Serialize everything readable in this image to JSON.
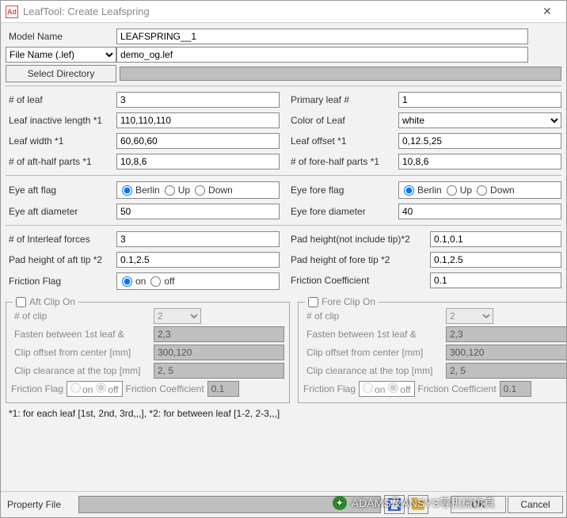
{
  "window": {
    "title": "LeafTool: Create Leafspring",
    "logo_text": "Ad"
  },
  "top": {
    "model_name_label": "Model Name",
    "model_name_value": "LEAFSPRING__1",
    "file_select_label": "File Name (.lef)",
    "file_name_value": "demo_og.lef",
    "select_dir_label": "Select Directory"
  },
  "left": {
    "num_leaf_label": "# of leaf",
    "num_leaf_value": "3",
    "inactive_len_label": "Leaf inactive length *1",
    "inactive_len_value": "110,110,110",
    "width_label": "Leaf width *1",
    "width_value": "60,60,60",
    "aft_half_label": "# of aft-half parts *1",
    "aft_half_value": "10,8,6",
    "eye_aft_flag_label": "Eye aft flag",
    "eye_opts": {
      "a": "Berlin",
      "b": "Up",
      "c": "Down"
    },
    "eye_aft_dia_label": "Eye aft diameter",
    "eye_aft_dia_value": "50",
    "interleaf_label": "# of Interleaf forces",
    "interleaf_value": "3",
    "pad_aft_tip_label": "Pad height of aft tip *2",
    "pad_aft_tip_value": "0.1,2.5",
    "friction_flag_label": "Friction Flag",
    "friction_opts": {
      "on": "on",
      "off": "off"
    }
  },
  "right": {
    "primary_leaf_label": "Primary leaf #",
    "primary_leaf_value": "1",
    "color_label": "Color of Leaf",
    "color_value": "white",
    "offset_label": "Leaf offset *1",
    "offset_value": "0,12.5,25",
    "fore_half_label": "# of fore-half parts *1",
    "fore_half_value": "10,8,6",
    "eye_fore_flag_label": "Eye fore flag",
    "eye_fore_dia_label": "Eye fore diameter",
    "eye_fore_dia_value": "40",
    "pad_height_label": "Pad height(not include tip)*2",
    "pad_height_value": "0.1,0.1",
    "pad_fore_tip_label": "Pad height of fore tip *2",
    "pad_fore_tip_value": "0.1,2.5",
    "friction_coef_label": "Friction Coefficient",
    "friction_coef_value": "0.1"
  },
  "clip": {
    "aft_legend": "Aft Clip On",
    "fore_legend": "Fore Clip On",
    "num_clip_label": "# of clip",
    "num_clip_value": "2",
    "fasten_label": "Fasten between 1st leaf &",
    "fasten_value": "2,3",
    "offset_label": "Clip offset from center [mm]",
    "offset_value": "300,120",
    "clearance_label": "Clip clearance at the top [mm]",
    "clearance_value": "2, 5",
    "friction_flag_label": "Friction Flag",
    "friction_on": "on",
    "friction_off": "off",
    "friction_coef_label": "Friction Coefficient",
    "friction_coef_value": "0.1"
  },
  "footnote": "*1: for each leaf [1st, 2nd, 3rd,,,],  *2: for between leaf [1-2, 2-3,,,]",
  "bottom": {
    "property_label": "Property File",
    "ok": "OK",
    "cancel": "Cancel"
  },
  "watermark": "ADAMS及ANSYS等机械仿真"
}
